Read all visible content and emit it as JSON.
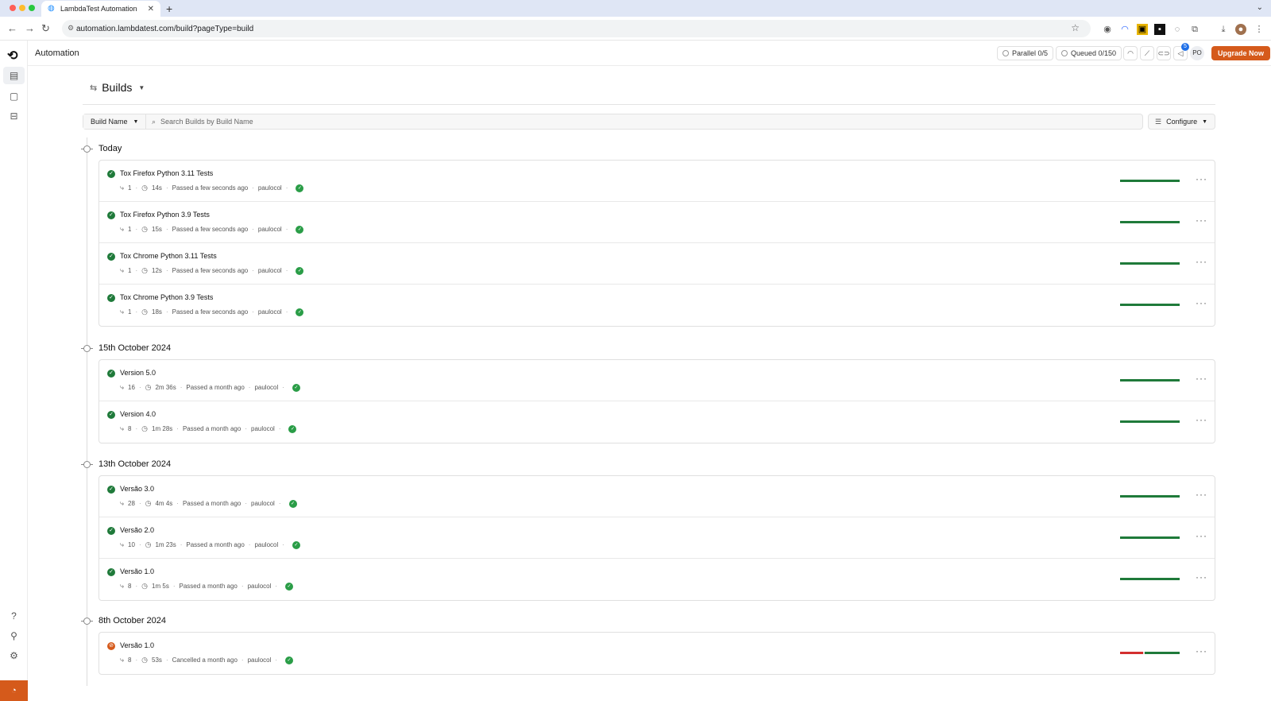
{
  "browser": {
    "tab_title": "LambdaTest Automation",
    "url": "automation.lambdatest.com/build?pageType=build"
  },
  "app": {
    "title": "Automation",
    "parallel": "Parallel 0/5",
    "queued": "Queued 0/150",
    "notification_count": "5",
    "user_initials": "PO",
    "upgrade_label": "Upgrade Now"
  },
  "page": {
    "title": "Builds",
    "filter_select": "Build Name",
    "search_placeholder": "Search Builds by Build Name",
    "configure_label": "Configure"
  },
  "groups": [
    {
      "label": "Today",
      "builds": [
        {
          "name": "Tox Firefox Python 3.11 Tests",
          "status": "passed",
          "count": "1",
          "duration": "14s",
          "when": "Passed a few seconds ago",
          "user": "paulocol",
          "pass_fraction": 1.0
        },
        {
          "name": "Tox Firefox Python 3.9 Tests",
          "status": "passed",
          "count": "1",
          "duration": "15s",
          "when": "Passed a few seconds ago",
          "user": "paulocol",
          "pass_fraction": 1.0
        },
        {
          "name": "Tox Chrome Python 3.11 Tests",
          "status": "passed",
          "count": "1",
          "duration": "12s",
          "when": "Passed a few seconds ago",
          "user": "paulocol",
          "pass_fraction": 1.0
        },
        {
          "name": "Tox Chrome Python 3.9 Tests",
          "status": "passed",
          "count": "1",
          "duration": "18s",
          "when": "Passed a few seconds ago",
          "user": "paulocol",
          "pass_fraction": 1.0
        }
      ]
    },
    {
      "label": "15th October 2024",
      "builds": [
        {
          "name": "Version 5.0",
          "status": "passed",
          "count": "16",
          "duration": "2m 36s",
          "when": "Passed a month ago",
          "user": "paulocol",
          "pass_fraction": 1.0
        },
        {
          "name": "Version 4.0",
          "status": "passed",
          "count": "8",
          "duration": "1m 28s",
          "when": "Passed a month ago",
          "user": "paulocol",
          "pass_fraction": 1.0
        }
      ]
    },
    {
      "label": "13th October 2024",
      "builds": [
        {
          "name": "Versão 3.0",
          "status": "passed",
          "count": "28",
          "duration": "4m 4s",
          "when": "Passed a month ago",
          "user": "paulocol",
          "pass_fraction": 1.0
        },
        {
          "name": "Versão 2.0",
          "status": "passed",
          "count": "10",
          "duration": "1m 23s",
          "when": "Passed a month ago",
          "user": "paulocol",
          "pass_fraction": 1.0
        },
        {
          "name": "Versão 1.0",
          "status": "passed",
          "count": "8",
          "duration": "1m 5s",
          "when": "Passed a month ago",
          "user": "paulocol",
          "pass_fraction": 1.0
        }
      ]
    },
    {
      "label": "8th October 2024",
      "builds": [
        {
          "name": "Versão 1.0",
          "status": "cancelled",
          "count": "8",
          "duration": "53s",
          "when": "Cancelled a month ago",
          "user": "paulocol",
          "pass_fraction": 0.62,
          "fail_fraction": 0.38
        }
      ]
    }
  ],
  "colors": {
    "accent": "#d55a1b",
    "passed": "#1f7a3a",
    "failed": "#d32f2f"
  }
}
